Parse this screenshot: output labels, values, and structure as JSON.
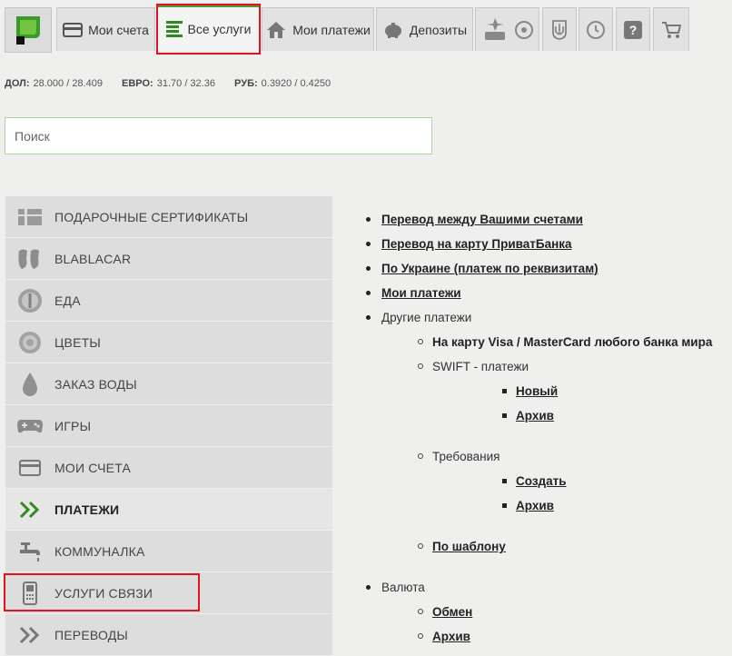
{
  "nav": {
    "logo_icon": "privatbank-logo-icon",
    "tabs": [
      {
        "label": "Мои счета",
        "icon": "card-icon"
      },
      {
        "label": "Все услуги",
        "icon": "list-icon"
      },
      {
        "label": "Мои платежи",
        "icon": "house-icon"
      },
      {
        "label": "Депозиты",
        "icon": "piggy-bank-icon"
      }
    ],
    "icon_tabs": [
      "travel-icon",
      "coat-of-arms-icon",
      "history-icon",
      "help-icon",
      "cart-icon"
    ],
    "help_glyph": "?"
  },
  "rates": {
    "usd_label": "ДОЛ:",
    "usd_value": "28.000 / 28.409",
    "eur_label": "ЕВРО:",
    "eur_value": "31.70 / 32.36",
    "rub_label": "РУБ:",
    "rub_value": "0.3920 / 0.4250"
  },
  "search": {
    "placeholder": "Поиск",
    "value": ""
  },
  "menu": [
    {
      "label": "ПОДАРОЧНЫЕ СЕРТИФИКАТЫ",
      "icon": "gift-card-icon"
    },
    {
      "label": "BLABLACAR",
      "icon": "blablacar-icon"
    },
    {
      "label": "ЕДА",
      "icon": "food-icon"
    },
    {
      "label": "ЦВЕТЫ",
      "icon": "flower-icon"
    },
    {
      "label": "ЗАКАЗ ВОДЫ",
      "icon": "water-drop-icon"
    },
    {
      "label": "ИГРЫ",
      "icon": "gamepad-icon"
    },
    {
      "label": "МОИ СЧЕТА",
      "icon": "card-icon"
    },
    {
      "label": "ПЛАТЕЖИ",
      "icon": "double-chevron-icon"
    },
    {
      "label": "КОММУНАЛКА",
      "icon": "faucet-icon"
    },
    {
      "label": "УСЛУГИ СВЯЗИ",
      "icon": "phone-icon"
    },
    {
      "label": "ПЕРЕВОДЫ",
      "icon": "double-chevron-icon"
    }
  ],
  "tree": {
    "transfer_own": "Перевод между Вашими счетами",
    "transfer_privat": "Перевод на карту ПриватБанка",
    "ukraine": "По Украине (платеж по реквизитам)",
    "my_payments": "Мои платежи",
    "other_payments": "Другие платежи",
    "any_bank": "На карту Visa / MasterCard любого банка мира",
    "swift": "SWIFT - платежи",
    "swift_new": "Новый",
    "swift_archive": "Архив",
    "requirements": "Требования",
    "req_create": "Создать",
    "req_archive": "Архив",
    "by_template": "По шаблону",
    "currency": "Валюта",
    "exchange": "Обмен",
    "currency_archive": "Архив"
  }
}
